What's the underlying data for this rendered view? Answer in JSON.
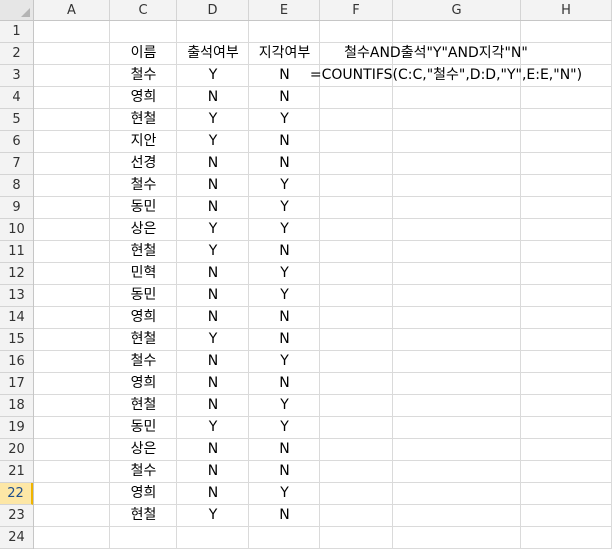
{
  "spreadsheet": {
    "columns": [
      "A",
      "C",
      "D",
      "E",
      "F",
      "G",
      "H"
    ],
    "rows": [
      "1",
      "2",
      "3",
      "4",
      "5",
      "6",
      "7",
      "8",
      "9",
      "10",
      "11",
      "12",
      "13",
      "14",
      "15",
      "16",
      "17",
      "18",
      "19",
      "20",
      "21",
      "22",
      "23",
      "24"
    ],
    "active_row": "22",
    "headers": {
      "name": "이름",
      "attendance": "출석여부",
      "late": "지각여부"
    },
    "records": [
      {
        "name": "철수",
        "attendance": "Y",
        "late": "N"
      },
      {
        "name": "영희",
        "attendance": "N",
        "late": "N"
      },
      {
        "name": "현철",
        "attendance": "Y",
        "late": "Y"
      },
      {
        "name": "지안",
        "attendance": "Y",
        "late": "N"
      },
      {
        "name": "선경",
        "attendance": "N",
        "late": "N"
      },
      {
        "name": "철수",
        "attendance": "N",
        "late": "Y"
      },
      {
        "name": "동민",
        "attendance": "N",
        "late": "Y"
      },
      {
        "name": "상은",
        "attendance": "Y",
        "late": "Y"
      },
      {
        "name": "현철",
        "attendance": "Y",
        "late": "N"
      },
      {
        "name": "민혁",
        "attendance": "N",
        "late": "Y"
      },
      {
        "name": "동민",
        "attendance": "N",
        "late": "Y"
      },
      {
        "name": "영희",
        "attendance": "N",
        "late": "N"
      },
      {
        "name": "현철",
        "attendance": "Y",
        "late": "N"
      },
      {
        "name": "철수",
        "attendance": "N",
        "late": "Y"
      },
      {
        "name": "영희",
        "attendance": "N",
        "late": "N"
      },
      {
        "name": "현철",
        "attendance": "N",
        "late": "Y"
      },
      {
        "name": "동민",
        "attendance": "Y",
        "late": "Y"
      },
      {
        "name": "상은",
        "attendance": "N",
        "late": "N"
      },
      {
        "name": "철수",
        "attendance": "N",
        "late": "N"
      },
      {
        "name": "영희",
        "attendance": "N",
        "late": "Y"
      },
      {
        "name": "현철",
        "attendance": "Y",
        "late": "N"
      }
    ],
    "formula_label": "철수AND출석\"Y\"AND지각\"N\"",
    "formula_text": "=COUNTIFS(C:C,\"철수\",D:D,\"Y\",E:E,\"N\")"
  }
}
